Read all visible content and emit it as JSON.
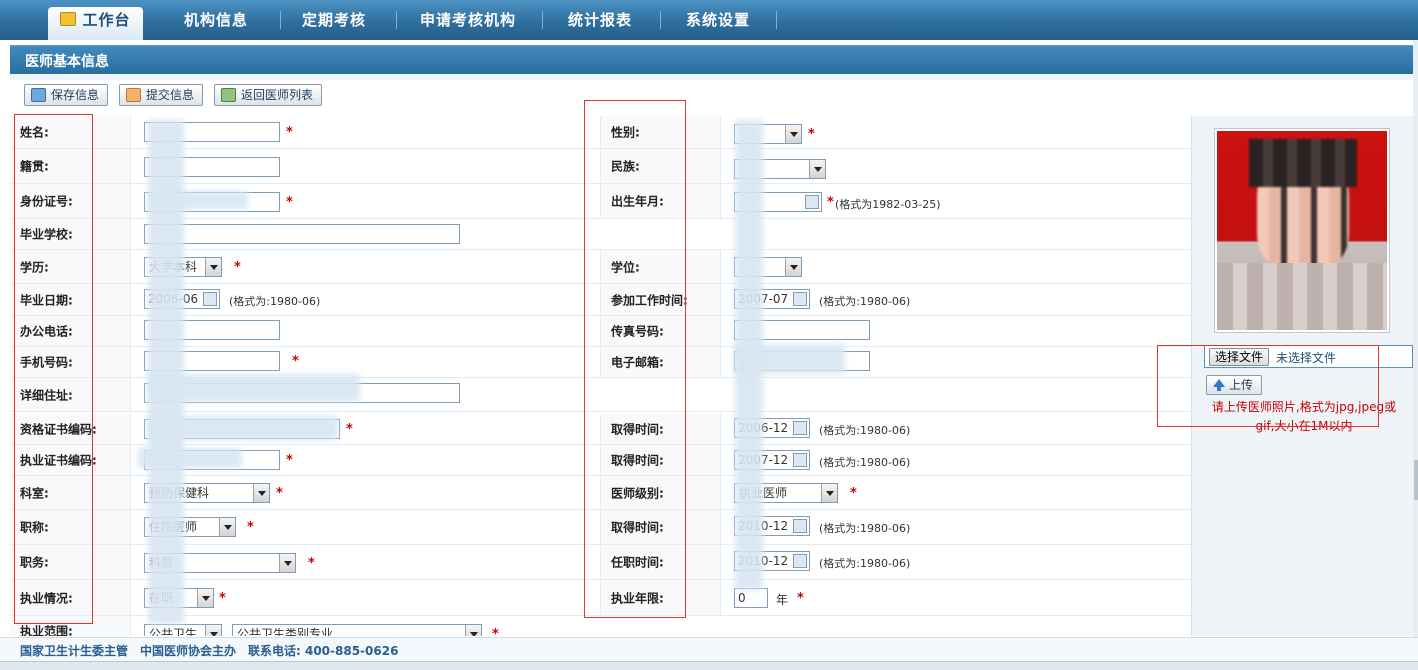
{
  "nav": {
    "tabs": [
      {
        "label": "工作台"
      },
      {
        "label": "机构信息"
      },
      {
        "label": "定期考核"
      },
      {
        "label": "申请考核机构"
      },
      {
        "label": "统计报表"
      },
      {
        "label": "系统设置"
      }
    ]
  },
  "section": {
    "title": "医师基本信息"
  },
  "toolbar": {
    "save_label": "保存信息",
    "submit_label": "提交信息",
    "back_label": "返回医师列表"
  },
  "form": {
    "name_label": "姓名:",
    "gender_label": "性别:",
    "native_label": "籍贯:",
    "ethnic_label": "民族:",
    "idcard_label": "身份证号:",
    "birth_label": "出生年月:",
    "birth_hint": "(格式为1982-03-25)",
    "school_label": "毕业学校:",
    "edu_label": "学历:",
    "edu_value": "大学本科",
    "degree_label": "学位:",
    "grad_label": "毕业日期:",
    "grad_value": "2006-06",
    "date_hint": "(格式为:1980-06)",
    "work_label": "参加工作时间:",
    "work_value": "2007-07",
    "office_label": "办公电话:",
    "fax_label": "传真号码:",
    "mobile_label": "手机号码:",
    "email_label": "电子邮箱:",
    "address_label": "详细住址:",
    "cert_label": "资格证书编码:",
    "obtain_label": "取得时间:",
    "cert_time_value": "2006-12",
    "license_label": "执业证书编码:",
    "license_time_value": "2007-12",
    "dept_label": "科室:",
    "dept_value": "预防保健科",
    "level_label": "医师级别:",
    "level_value": "执业医师",
    "title_label": "职称:",
    "title_value": "住院医师",
    "title_time_value": "2010-12",
    "post_label": "职务:",
    "post_value": "科员",
    "appoint_label": "任职时间:",
    "appoint_value": "2010-12",
    "status_label": "执业情况:",
    "status_value": "在职",
    "years_label": "执业年限:",
    "years_value": "0",
    "years_unit": "年",
    "scope_label": "执业范围:",
    "scope_type": "公共卫生",
    "scope_value": "公共卫生类别专业",
    "required_mark": "*"
  },
  "photo": {
    "choose_label": "选择文件",
    "file_status": "未选择文件",
    "upload_label": "上传",
    "note": "请上传医师照片,格式为jpg,jpeg或gif,大小在1M以内"
  },
  "footer": {
    "text": "国家卫生计生委主管　中国医师协会主办　联系电话: 400-885-0626"
  },
  "colors": {
    "nav": "#2f6f9e",
    "accent": "#3f8bbf",
    "required": "#cc0000"
  }
}
